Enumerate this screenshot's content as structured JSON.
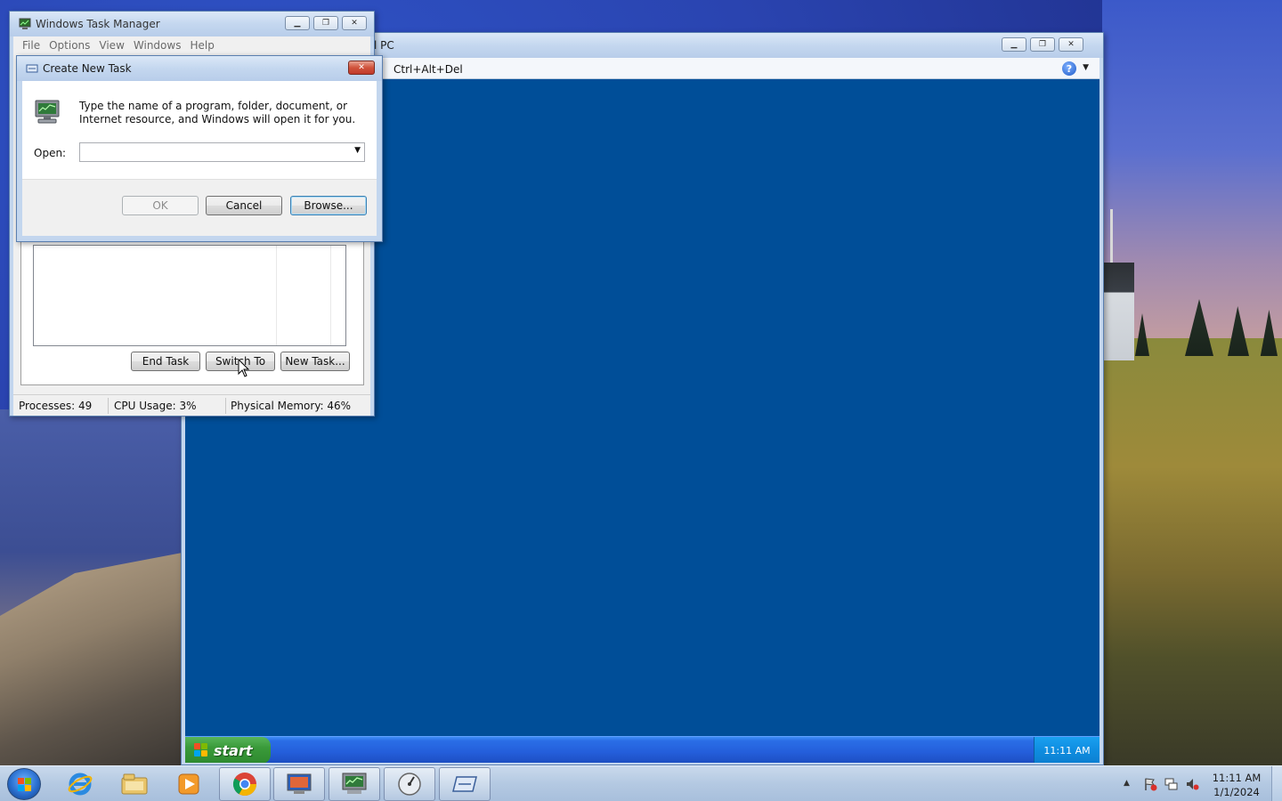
{
  "vpc_window": {
    "title_partial": "l PC",
    "toolbar": {
      "ctrl_alt_del": "Ctrl+Alt+Del",
      "help_label": "?"
    },
    "xp_taskbar": {
      "start_label": "start",
      "clock": "11:11 AM"
    }
  },
  "task_manager": {
    "title": "Windows Task Manager",
    "menu": [
      "File",
      "Options",
      "View",
      "Windows",
      "Help"
    ],
    "buttons": {
      "end_task": "End Task",
      "switch_to": "Switch To",
      "new_task": "New Task..."
    },
    "status": {
      "processes": "Processes: 49",
      "cpu": "CPU Usage: 3%",
      "memory": "Physical Memory: 46%"
    }
  },
  "create_new_task": {
    "title": "Create New Task",
    "message": "Type the name of a program, folder, document, or Internet resource, and Windows will open it for you.",
    "open_label": "Open:",
    "open_value": "",
    "buttons": {
      "ok": "OK",
      "cancel": "Cancel",
      "browse": "Browse..."
    }
  },
  "taskbar": {
    "clock_time": "11:11 AM",
    "clock_date": "1/1/2024",
    "pinned": [
      "internet-explorer-icon",
      "windows-explorer-icon",
      "media-player-icon",
      "chrome-icon",
      "virtual-pc-icon",
      "task-manager-icon",
      "performance-icon",
      "run-dialog-icon"
    ]
  },
  "colors": {
    "xp_desktop": "#004e98",
    "xp_start_green": "#3a9a3a",
    "xp_tray_blue": "#0f8de0",
    "win7_taskbar": "#b4c9e2",
    "close_red": "#c0392b"
  }
}
